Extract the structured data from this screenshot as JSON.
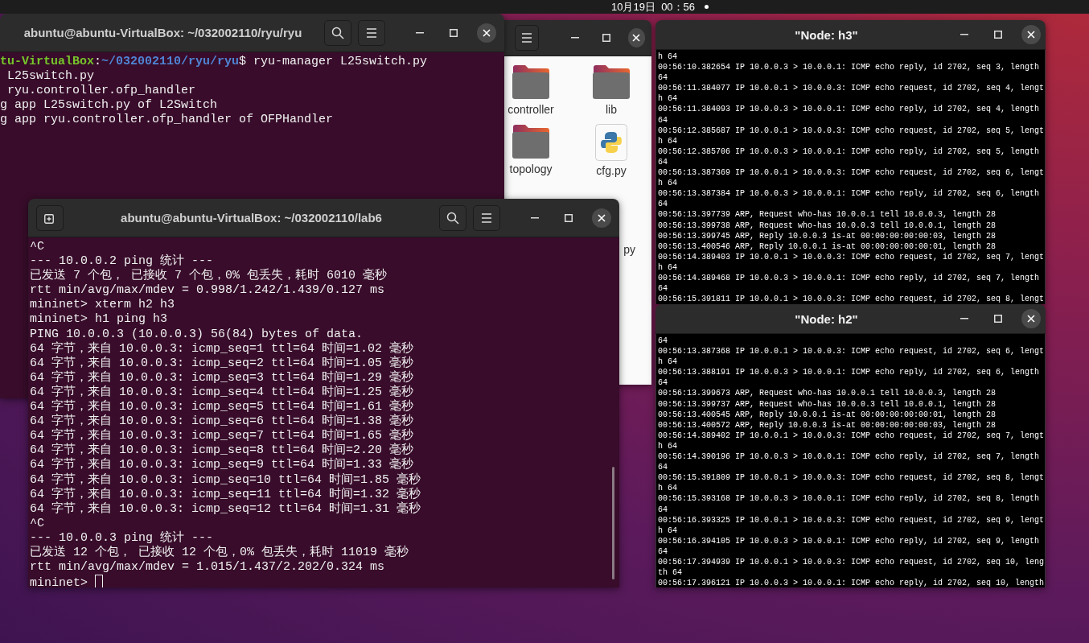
{
  "top_bar": {
    "clock": "10月19日  00：56"
  },
  "windows": [
    {
      "kind": "terminal",
      "title": "abuntu@abuntu-VirtualBox: ~/032002110/ryu/ryu",
      "lines": [
        {
          "kind": "prompt",
          "host": "tu-VirtualBox",
          "separator": ":",
          "path": "~/032002110/ryu/ryu",
          "command": "$ ryu-manager L25switch.py"
        },
        {
          "kind": "output",
          "text": " L25switch.py"
        },
        {
          "kind": "output",
          "text": " ryu.controller.ofp_handler"
        },
        {
          "kind": "output",
          "text": "g app L25switch.py of L2Switch"
        },
        {
          "kind": "output",
          "text": "g app ryu.controller.ofp_handler of OFPHandler"
        }
      ]
    },
    {
      "kind": "terminal",
      "title": "abuntu@abuntu-VirtualBox: ~/032002110/lab6",
      "cursor": true,
      "lines": [
        {
          "kind": "output",
          "text": "^C"
        },
        {
          "kind": "output",
          "text": "--- 10.0.0.2 ping 统计 ---"
        },
        {
          "kind": "output",
          "text": "已发送 7 个包， 已接收 7 个包，0% 包丢失，耗时 6010 毫秒"
        },
        {
          "kind": "output",
          "text": "rtt min/avg/max/mdev = 0.998/1.242/1.439/0.127 ms"
        },
        {
          "kind": "output",
          "text": "mininet> xterm h2 h3"
        },
        {
          "kind": "output",
          "text": "mininet> h1 ping h3"
        },
        {
          "kind": "output",
          "text": "PING 10.0.0.3 (10.0.0.3) 56(84) bytes of data."
        },
        {
          "kind": "output",
          "text": "64 字节，来自 10.0.0.3: icmp_seq=1 ttl=64 时间=1.02 毫秒"
        },
        {
          "kind": "output",
          "text": "64 字节，来自 10.0.0.3: icmp_seq=2 ttl=64 时间=1.05 毫秒"
        },
        {
          "kind": "output",
          "text": "64 字节，来自 10.0.0.3: icmp_seq=3 ttl=64 时间=1.29 毫秒"
        },
        {
          "kind": "output",
          "text": "64 字节，来自 10.0.0.3: icmp_seq=4 ttl=64 时间=1.25 毫秒"
        },
        {
          "kind": "output",
          "text": "64 字节，来自 10.0.0.3: icmp_seq=5 ttl=64 时间=1.61 毫秒"
        },
        {
          "kind": "output",
          "text": "64 字节，来自 10.0.0.3: icmp_seq=6 ttl=64 时间=1.38 毫秒"
        },
        {
          "kind": "output",
          "text": "64 字节，来自 10.0.0.3: icmp_seq=7 ttl=64 时间=1.65 毫秒"
        },
        {
          "kind": "output",
          "text": "64 字节，来自 10.0.0.3: icmp_seq=8 ttl=64 时间=2.20 毫秒"
        },
        {
          "kind": "output",
          "text": "64 字节，来自 10.0.0.3: icmp_seq=9 ttl=64 时间=1.33 毫秒"
        },
        {
          "kind": "output",
          "text": "64 字节，来自 10.0.0.3: icmp_seq=10 ttl=64 时间=1.85 毫秒"
        },
        {
          "kind": "output",
          "text": "64 字节，来自 10.0.0.3: icmp_seq=11 ttl=64 时间=1.32 毫秒"
        },
        {
          "kind": "output",
          "text": "64 字节，来自 10.0.0.3: icmp_seq=12 ttl=64 时间=1.31 毫秒"
        },
        {
          "kind": "output",
          "text": "^C"
        },
        {
          "kind": "output",
          "text": "--- 10.0.0.3 ping 统计 ---"
        },
        {
          "kind": "output",
          "text": "已发送 12 个包， 已接收 12 个包，0% 包丢失，耗时 11019 毫秒"
        },
        {
          "kind": "output",
          "text": "rtt min/avg/max/mdev = 1.015/1.437/2.202/0.324 ms"
        },
        {
          "kind": "output",
          "text": "mininet> "
        }
      ]
    },
    {
      "kind": "files",
      "items": [
        {
          "label": "controller",
          "kind": "folder"
        },
        {
          "label": "lib",
          "kind": "folder"
        },
        {
          "label": "topology",
          "kind": "folder"
        },
        {
          "label": "cfg.py",
          "kind": "python"
        },
        {
          "label": "py",
          "kind": "hidden"
        }
      ]
    },
    {
      "kind": "xterm",
      "title": "\"Node: h3\"",
      "lines": [
        "h 64",
        "00:56:10.382654 IP 10.0.0.3 > 10.0.0.1: ICMP echo reply, id 2702, seq 3, length",
        "64",
        "00:56:11.384077 IP 10.0.0.1 > 10.0.0.3: ICMP echo request, id 2702, seq 4, lengt",
        "h 64",
        "00:56:11.384093 IP 10.0.0.3 > 10.0.0.1: ICMP echo reply, id 2702, seq 4, length",
        "64",
        "00:56:12.385687 IP 10.0.0.1 > 10.0.0.3: ICMP echo request, id 2702, seq 5, lengt",
        "h 64",
        "00:56:12.385706 IP 10.0.0.3 > 10.0.0.1: ICMP echo reply, id 2702, seq 5, length",
        "64",
        "00:56:13.387369 IP 10.0.0.1 > 10.0.0.3: ICMP echo request, id 2702, seq 6, lengt",
        "h 64",
        "00:56:13.387384 IP 10.0.0.3 > 10.0.0.1: ICMP echo reply, id 2702, seq 6, length",
        "64",
        "00:56:13.397739 ARP, Request who-has 10.0.0.1 tell 10.0.0.3, length 28",
        "00:56:13.399738 ARP, Request who-has 10.0.0.3 tell 10.0.0.1, length 28",
        "00:56:13.399745 ARP, Reply 10.0.0.3 is-at 00:00:00:00:00:03, length 28",
        "00:56:13.400546 ARP, Reply 10.0.0.1 is-at 00:00:00:00:00:01, length 28",
        "00:56:14.389403 IP 10.0.0.1 > 10.0.0.3: ICMP echo request, id 2702, seq 7, lengt",
        "h 64",
        "00:56:14.389468 IP 10.0.0.3 > 10.0.0.1: ICMP echo reply, id 2702, seq 7, length",
        "64",
        "00:56:15.391811 IP 10.0.0.1 > 10.0.0.3: ICMP echo request, id 2702, seq 8, lengt"
      ]
    },
    {
      "kind": "xterm",
      "title": "\"Node: h2\"",
      "lines": [
        "64",
        "00:56:13.387368 IP 10.0.0.1 > 10.0.0.3: ICMP echo request, id 2702, seq 6, lengt",
        "h 64",
        "00:56:13.388191 IP 10.0.0.3 > 10.0.0.1: ICMP echo reply, id 2702, seq 6, length",
        "64",
        "00:56:13.399673 ARP, Request who-has 10.0.0.1 tell 10.0.0.3, length 28",
        "00:56:13.399737 ARP, Request who-has 10.0.0.3 tell 10.0.0.1, length 28",
        "00:56:13.400545 ARP, Reply 10.0.0.1 is-at 00:00:00:00:00:01, length 28",
        "00:56:13.400572 ARP, Reply 10.0.0.3 is-at 00:00:00:00:00:03, length 28",
        "00:56:14.389402 IP 10.0.0.1 > 10.0.0.3: ICMP echo request, id 2702, seq 7, lengt",
        "h 64",
        "00:56:14.390196 IP 10.0.0.3 > 10.0.0.1: ICMP echo reply, id 2702, seq 7, length",
        "64",
        "00:56:15.391809 IP 10.0.0.1 > 10.0.0.3: ICMP echo request, id 2702, seq 8, lengt",
        "h 64",
        "00:56:15.393168 IP 10.0.0.3 > 10.0.0.1: ICMP echo reply, id 2702, seq 8, length",
        "64",
        "00:56:16.393325 IP 10.0.0.1 > 10.0.0.3: ICMP echo request, id 2702, seq 9, lengt",
        "h 64",
        "00:56:16.394105 IP 10.0.0.3 > 10.0.0.1: ICMP echo reply, id 2702, seq 9, length",
        "64",
        "00:56:17.394939 IP 10.0.0.1 > 10.0.0.3: ICMP echo request, id 2702, seq 10, leng",
        "th 64",
        "00:56:17.396121 IP 10.0.0.3 > 10.0.0.1: ICMP echo reply, id 2702, seq 10, length"
      ]
    }
  ]
}
